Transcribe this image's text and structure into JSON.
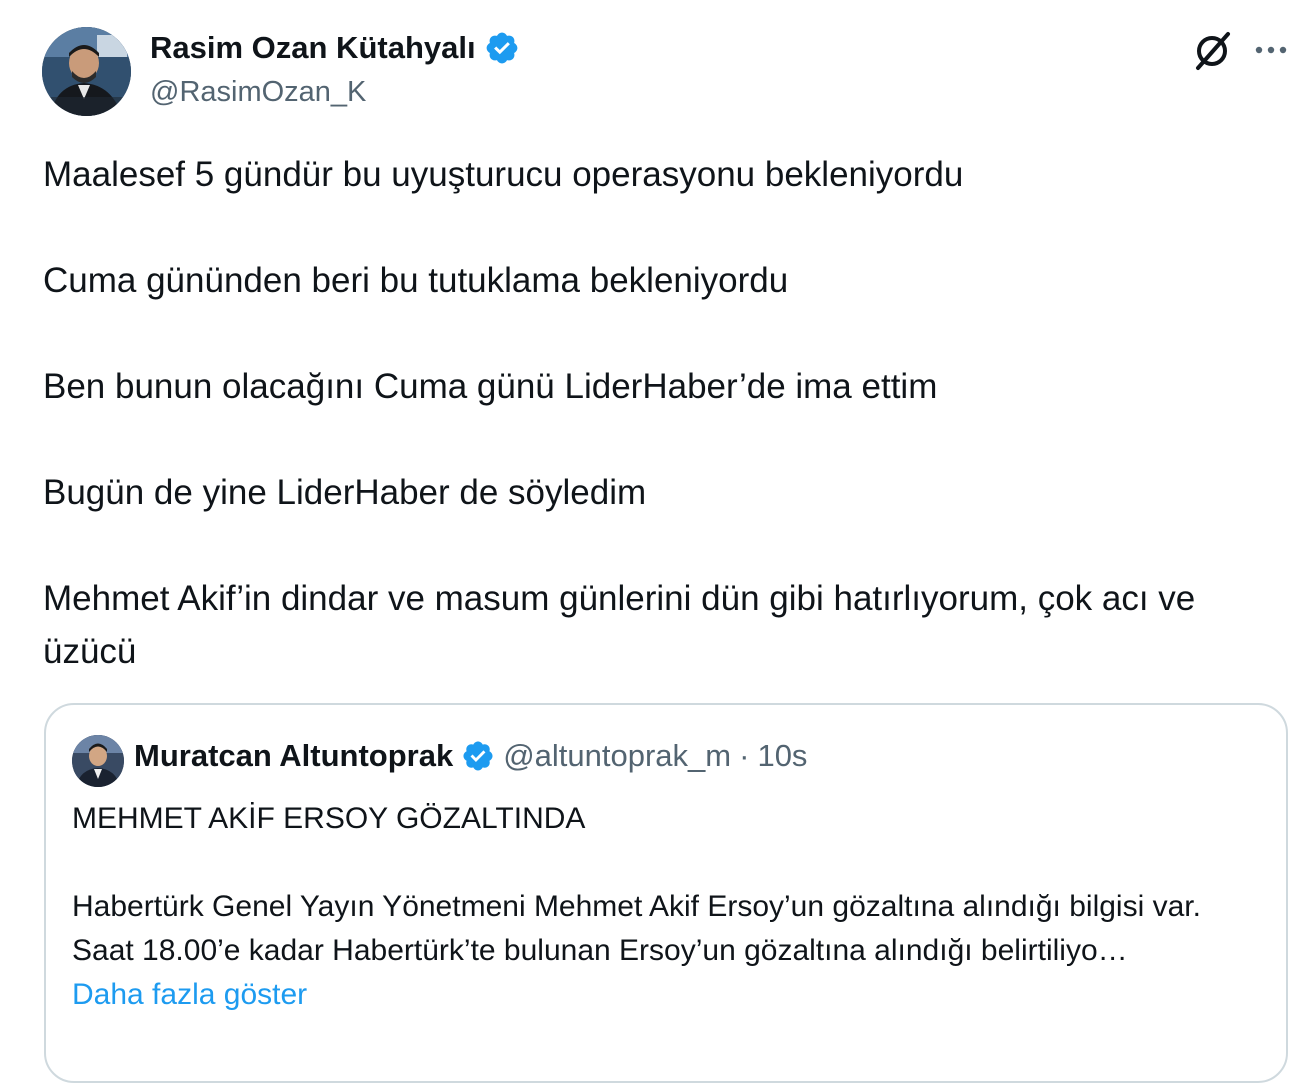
{
  "author": {
    "name": "Rasim Ozan Kütahyalı",
    "handle": "@RasimOzan_K",
    "verified": true
  },
  "icons": {
    "verified": "verified-badge-icon",
    "grok": "grok-icon",
    "more": "more-options-icon"
  },
  "colors": {
    "accent": "#1d9bf0",
    "secondary_text": "#536471",
    "border": "#cfd9de"
  },
  "tweet": {
    "paragraphs": [
      "Maalesef 5 gündür bu uyuşturucu operasyonu bekleniyordu",
      "Cuma gününden beri bu tutuklama bekleniyordu",
      "Ben bunun olacağını Cuma günü LiderHaber’de ima ettim",
      "Bugün de yine LiderHaber de söyledim",
      "Mehmet Akif’in dindar ve masum günlerini dün gibi hatırlıyorum, çok acı ve üzücü"
    ]
  },
  "quote": {
    "name": "Muratcan Altuntoprak",
    "handle": "@altuntoprak_m",
    "separator": "·",
    "time": "10s",
    "headline": "MEHMET AKİF ERSOY GÖZALTINDA",
    "lines": [
      "Habertürk Genel Yayın Yönetmeni Mehmet Akif Ersoy’un gözaltına alındığı bilgisi var.",
      "Saat 18.00’e kadar Habertürk’te bulunan Ersoy’un gözaltına alındığı belirtiliyo…"
    ],
    "show_more": "Daha fazla göster"
  }
}
